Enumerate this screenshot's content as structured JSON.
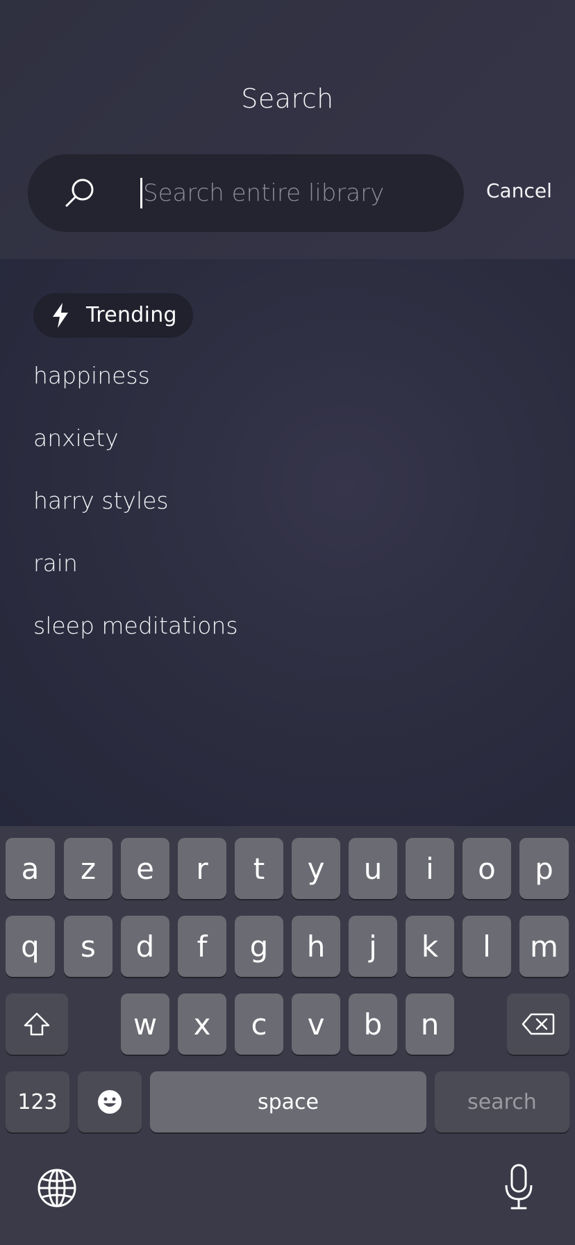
{
  "header": {
    "title": "Search",
    "search_placeholder": "Search entire library",
    "search_value": "",
    "cancel_label": "Cancel"
  },
  "trending": {
    "label": "Trending",
    "items": [
      "happiness",
      "anxiety",
      "harry styles",
      "rain",
      "sleep meditations"
    ]
  },
  "keyboard": {
    "row1": [
      "a",
      "z",
      "e",
      "r",
      "t",
      "y",
      "u",
      "i",
      "o",
      "p"
    ],
    "row2": [
      "q",
      "s",
      "d",
      "f",
      "g",
      "h",
      "j",
      "k",
      "l",
      "m"
    ],
    "row3": [
      "w",
      "x",
      "c",
      "v",
      "b",
      "n"
    ],
    "numbers_label": "123",
    "space_label": "space",
    "search_label": "search"
  },
  "icons": {
    "search": "search-icon",
    "trending": "bolt-icon",
    "shift": "shift-icon",
    "backspace": "backspace-icon",
    "emoji": "emoji-icon",
    "globe": "globe-icon",
    "mic": "microphone-icon"
  }
}
